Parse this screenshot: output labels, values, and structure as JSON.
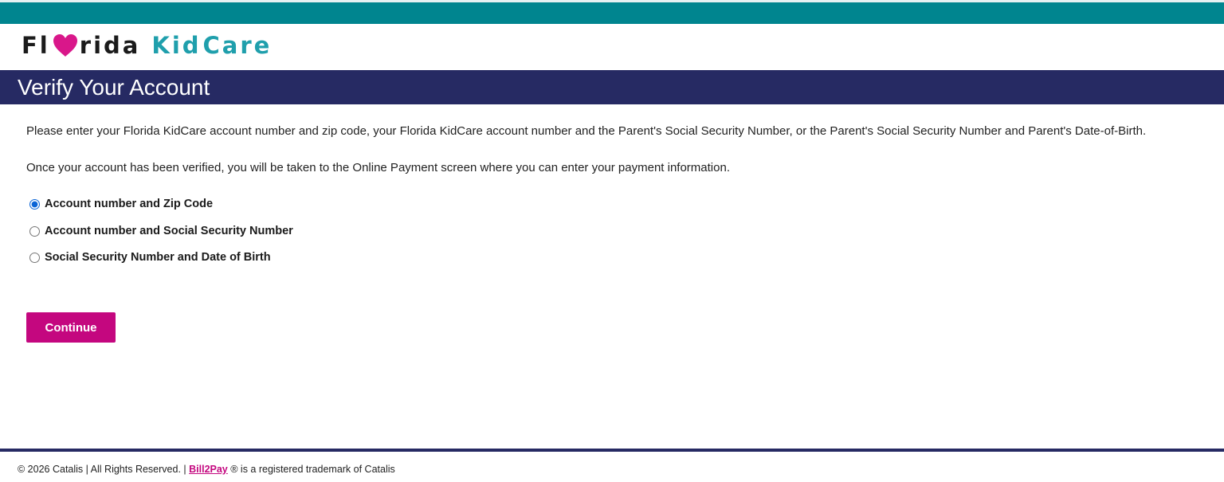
{
  "brand": {
    "logo_part1": "Fl",
    "logo_part2": "rida",
    "logo_part3": "Kid",
    "logo_part4": "Care",
    "colors": {
      "teal_band": "#00858f",
      "navy": "#262a63",
      "heart_pink": "#d9178a",
      "kidcare_teal": "#1f9fac",
      "button_magenta": "#c4077f"
    }
  },
  "header": {
    "title": "Verify Your Account"
  },
  "main": {
    "instructions": "Please enter your Florida KidCare account number and zip code, your Florida KidCare account number and the Parent's Social Security Number, or the Parent's Social Security Number and Parent's Date-of-Birth.",
    "note": "Once your account has been verified, you will be taken to the Online Payment screen where you can enter your payment information.",
    "options": [
      {
        "label": "Account number and Zip Code",
        "selected": true
      },
      {
        "label": "Account number and Social Security Number",
        "selected": false
      },
      {
        "label": "Social Security Number and Date of Birth",
        "selected": false
      }
    ],
    "continue_label": "Continue"
  },
  "footer": {
    "copyright": "© 2026 Catalis | All Rights Reserved. |",
    "link_text": "Bill2Pay",
    "trademark": "® is a registered trademark of Catalis"
  }
}
